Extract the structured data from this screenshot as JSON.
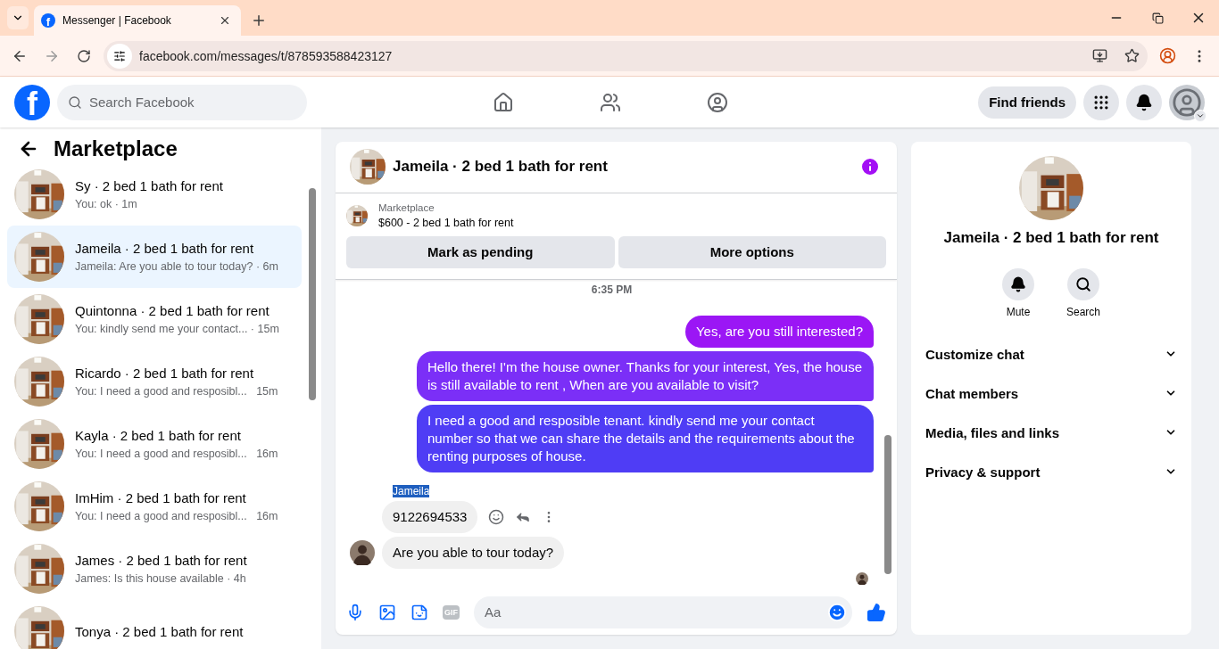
{
  "browser": {
    "tab_title": "Messenger | Facebook",
    "favicon_letter": "f",
    "url": "facebook.com/messages/t/878593588423127"
  },
  "topbar": {
    "logo_letter": "f",
    "search_placeholder": "Search Facebook",
    "find_friends": "Find friends"
  },
  "sidebar": {
    "title": "Marketplace",
    "conversations": [
      {
        "title": "Sy · 2 bed 1 bath for rent",
        "preview": "You: ok · 1m",
        "selected": false
      },
      {
        "title": "Jameila · 2 bed 1 bath for rent",
        "preview": "Jameila: Are you able to tour today? · 6m",
        "selected": true
      },
      {
        "title": "Quintonna · 2 bed 1 bath for rent",
        "preview": "You: kindly send me your contact... · 15m",
        "selected": false
      },
      {
        "title": "Ricardo · 2 bed 1 bath for rent",
        "preview": "You: I need a good and resposibl...   15m",
        "selected": false
      },
      {
        "title": "Kayla · 2 bed 1 bath for rent",
        "preview": "You: I need a good and resposibl...   16m",
        "selected": false
      },
      {
        "title": "ImHim · 2 bed 1 bath for rent",
        "preview": "You: I need a good and resposibl...   16m",
        "selected": false
      },
      {
        "title": "James · 2 bed 1 bath for rent",
        "preview": "James: Is this house available · 4h",
        "selected": false
      },
      {
        "title": "Tonya · 2 bed 1 bath for rent",
        "selected": false
      }
    ]
  },
  "chat": {
    "title": "Jameila · 2 bed 1 bath for rent",
    "listing": {
      "source": "Marketplace",
      "text": "$600 - 2 bed 1 bath for rent"
    },
    "actions": [
      "Mark as pending",
      "More options"
    ],
    "timestamp": "6:35 PM",
    "messages": [
      {
        "kind": "out",
        "text": "Yes, are you still interested?"
      },
      {
        "kind": "out",
        "text": "Hello there! I'm the house owner. Thanks for your interest, Yes, the house is still available to rent , When are you available to visit?"
      },
      {
        "kind": "out",
        "text": "I need a good and resposible tenant.  kindly send me your contact number so that we can share the details and the requirements about the renting purposes of house."
      },
      {
        "kind": "sender",
        "text": "Jameila",
        "highlighted": true
      },
      {
        "kind": "in",
        "text": "9122694533",
        "hovered": true
      },
      {
        "kind": "in",
        "text": "Are you able to tour today?",
        "avatar": true
      }
    ],
    "composer": {
      "gif": "GIF",
      "placeholder": "Aa"
    }
  },
  "info": {
    "title": "Jameila · 2 bed 1 bath for rent",
    "actions": [
      {
        "kind": "mute",
        "label": "Mute"
      },
      {
        "kind": "search",
        "label": "Search"
      }
    ],
    "sections": [
      {
        "label": "Customize chat",
        "expanded": false
      },
      {
        "label": "Chat members",
        "expanded": false
      },
      {
        "label": "Media, files and links",
        "expanded": false
      },
      {
        "label": "Privacy & support",
        "expanded": false
      }
    ]
  }
}
